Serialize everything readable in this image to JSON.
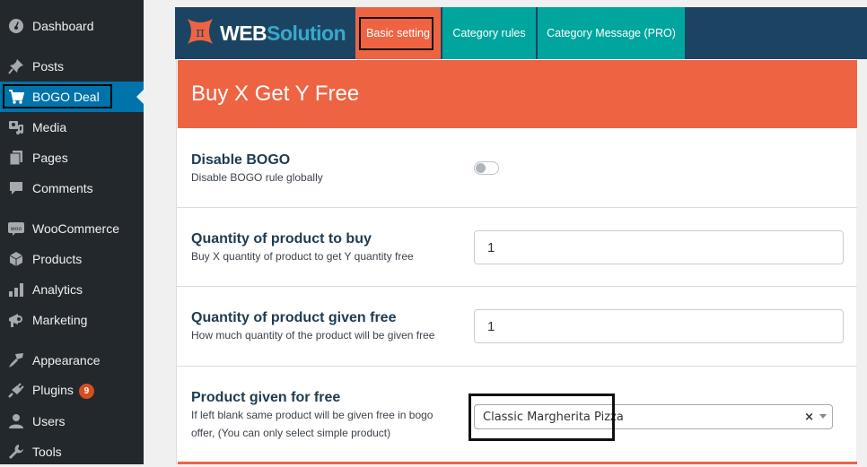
{
  "sidebar": {
    "items": [
      {
        "label": "Dashboard",
        "icon": "dashboard-icon"
      },
      {
        "label": "Posts",
        "icon": "pin-icon"
      },
      {
        "label": "BOGO Deal",
        "icon": "cart-icon",
        "active": true
      },
      {
        "label": "Media",
        "icon": "media-icon"
      },
      {
        "label": "Pages",
        "icon": "pages-icon"
      },
      {
        "label": "Comments",
        "icon": "comment-icon"
      },
      {
        "label": "WooCommerce",
        "icon": "woo-icon"
      },
      {
        "label": "Products",
        "icon": "box-icon"
      },
      {
        "label": "Analytics",
        "icon": "bar-chart-icon"
      },
      {
        "label": "Marketing",
        "icon": "megaphone-icon"
      },
      {
        "label": "Appearance",
        "icon": "brush-icon"
      },
      {
        "label": "Plugins",
        "icon": "plug-icon",
        "badge": "9"
      },
      {
        "label": "Users",
        "icon": "user-icon"
      },
      {
        "label": "Tools",
        "icon": "wrench-icon"
      }
    ]
  },
  "header": {
    "logo_web": "WEB",
    "logo_solution": "Solution",
    "logo_symbol": "π",
    "tabs": [
      {
        "label": "Basic setting",
        "active": true
      },
      {
        "label": "Category rules"
      },
      {
        "label": "Category Message (PRO)"
      }
    ]
  },
  "panel": {
    "title": "Buy X Get Y Free",
    "settings": [
      {
        "title": "Disable BOGO",
        "desc": "Disable BOGO rule globally",
        "type": "toggle",
        "value": false
      },
      {
        "title": "Quantity of product to buy",
        "desc": "Buy X quantity of product to get Y quantity free",
        "type": "number",
        "value": "1"
      },
      {
        "title": "Quantity of product given free",
        "desc": "How much quantity of the product will be given free",
        "type": "number",
        "value": "1"
      },
      {
        "title": "Product given for free",
        "desc": "If left blank same product will be given free in bogo offer, (You can only select simple product)",
        "type": "select",
        "value": "Classic Margherita Pizza",
        "clear": "×"
      }
    ]
  },
  "colors": {
    "accent_orange": "#ee6443",
    "teal": "#00a59e",
    "navy": "#1b4463",
    "wp_blue": "#0073aa",
    "sidebar_bg": "#23282d"
  }
}
